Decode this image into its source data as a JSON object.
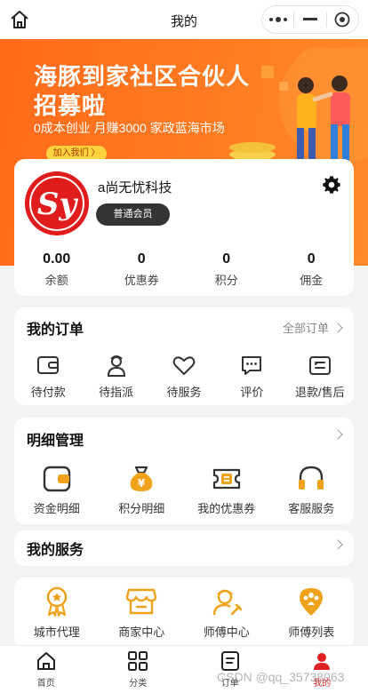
{
  "topbar": {
    "title": "我的"
  },
  "banner": {
    "headline1": "海豚到家社区合伙人",
    "headline2": "招募啦",
    "subline": "0成本创业 月赚3000 家政蓝海市场",
    "join_label": "加入我们 〉"
  },
  "profile": {
    "avatar_text": "Sy",
    "name": "a尚无忧科技",
    "member_badge": "普通会员",
    "stats": [
      {
        "value": "0.00",
        "label": "余额"
      },
      {
        "value": "0",
        "label": "优惠券"
      },
      {
        "value": "0",
        "label": "积分"
      },
      {
        "value": "0",
        "label": "佣金"
      }
    ]
  },
  "orders": {
    "title": "我的订单",
    "all_label": "全部订单",
    "items": [
      {
        "icon": "wallet-icon",
        "label": "待付款"
      },
      {
        "icon": "delivery-person-icon",
        "label": "待指派"
      },
      {
        "icon": "heart-icon",
        "label": "待服务"
      },
      {
        "icon": "chat-bubble-icon",
        "label": "评价"
      },
      {
        "icon": "return-icon",
        "label": "退款/售后"
      }
    ]
  },
  "detail": {
    "title": "明细管理",
    "items": [
      {
        "icon": "wallet-icon",
        "label": "资金明细"
      },
      {
        "icon": "money-bag-icon",
        "label": "积分明细"
      },
      {
        "icon": "coupon-icon",
        "label": "我的优惠券"
      },
      {
        "icon": "headset-icon",
        "label": "客服服务"
      }
    ]
  },
  "services": {
    "title": "我的服务",
    "items": [
      {
        "icon": "medal-icon",
        "label": "城市代理"
      },
      {
        "icon": "shop-icon",
        "label": "商家中心"
      },
      {
        "icon": "worker-icon",
        "label": "师傅中心"
      },
      {
        "icon": "location-people-icon",
        "label": "师傅列表"
      }
    ]
  },
  "tabbar": {
    "items": [
      {
        "icon": "home-icon",
        "label": "首页"
      },
      {
        "icon": "grid-icon",
        "label": "分类"
      },
      {
        "icon": "order-icon",
        "label": "订单"
      },
      {
        "icon": "user-icon",
        "label": "我的",
        "active": true
      }
    ]
  },
  "watermark": "CSDN @qq_35738963",
  "colors": {
    "accent": "#ff7a1f",
    "active_tab": "#e02020",
    "icon_orange": "#f0a21b",
    "icon_dark": "#333333"
  }
}
